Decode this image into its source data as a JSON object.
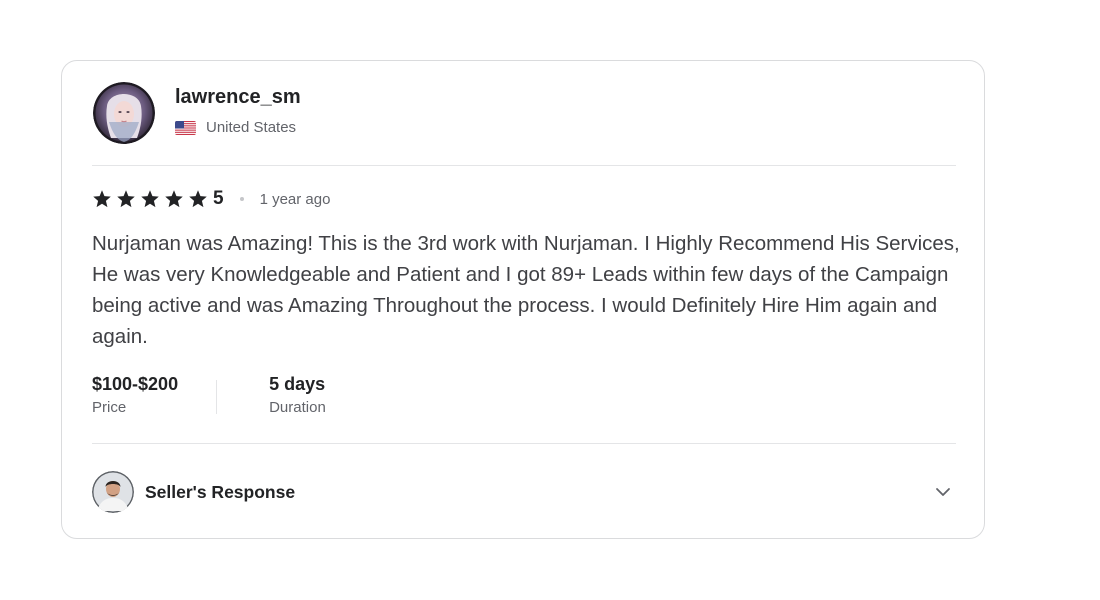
{
  "reviewer": {
    "username": "lawrence_sm",
    "country": "United States",
    "avatar_icon": "user-avatar-photo",
    "flag_icon": "us-flag-icon"
  },
  "rating": {
    "stars": 5,
    "value": "5",
    "time_ago": "1 year ago",
    "star_color": "#222325"
  },
  "review": {
    "text": "Nurjaman was Amazing! This is the 3rd work with Nurjaman. I Highly Recommend His Services, He was very Knowledgeable and Patient and I got 89+ Leads within few days of the Campaign being active and was Amazing Throughout the process. I would Definitely Hire Him again and again."
  },
  "meta": {
    "price_value": "$100-$200",
    "price_label": "Price",
    "duration_value": "5 days",
    "duration_label": "Duration"
  },
  "seller_response": {
    "label": "Seller's Response",
    "avatar_icon": "seller-avatar-photo",
    "toggle_icon": "chevron-down-icon"
  }
}
